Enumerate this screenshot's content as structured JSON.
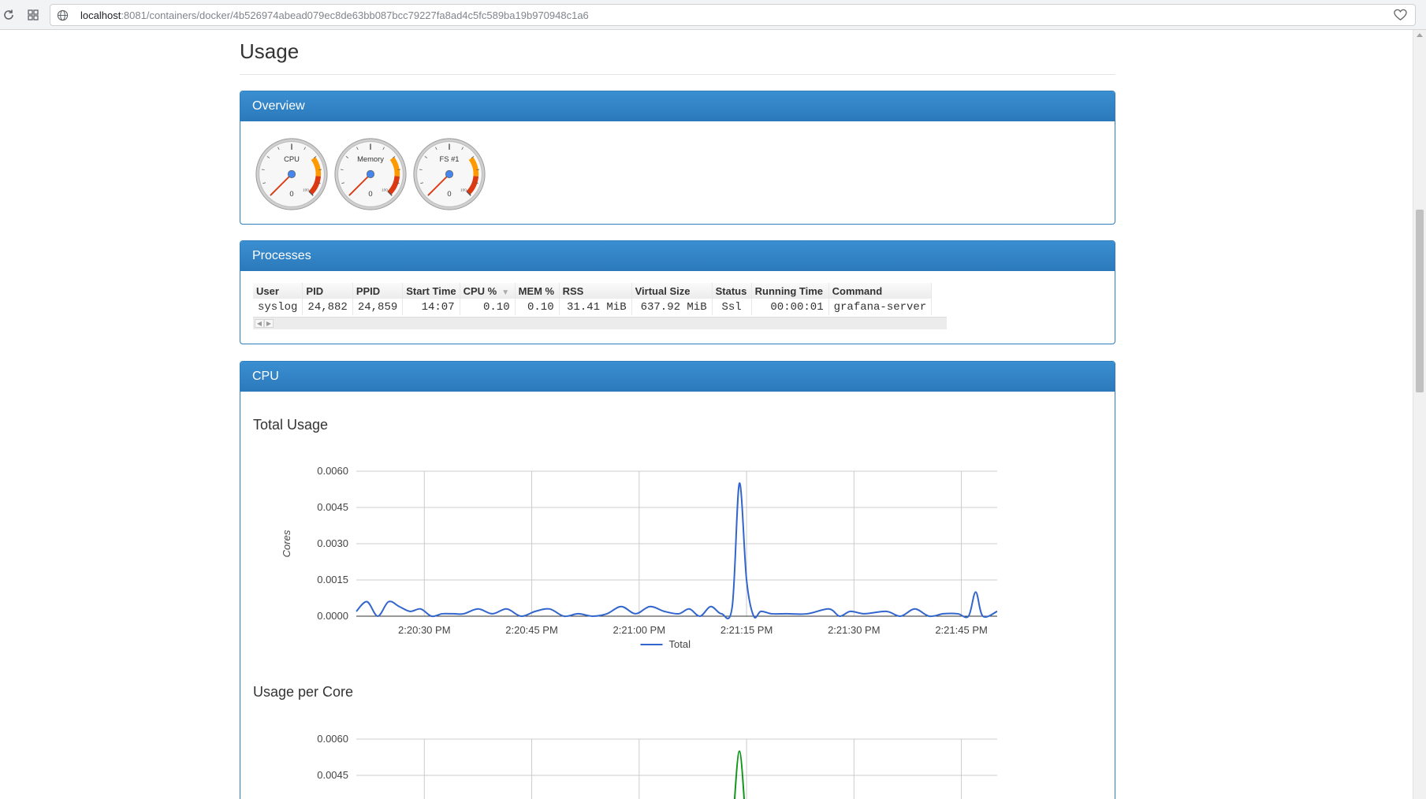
{
  "browser": {
    "url_host": "localhost",
    "url_path": ":8081/containers/docker/4b526974abead079ec8de63bb087bcc79227fa8ad4c5fc589ba19b970948c1a6"
  },
  "page": {
    "title": "Usage"
  },
  "overview": {
    "heading": "Overview",
    "gauges": [
      {
        "label": "CPU",
        "value": "0",
        "max_tick": "100",
        "level": 0
      },
      {
        "label": "Memory",
        "value": "0",
        "max_tick": "100",
        "level": 0
      },
      {
        "label": "FS #1",
        "value": "0",
        "max_tick": "100",
        "level": 0
      }
    ]
  },
  "processes": {
    "heading": "Processes",
    "columns": [
      "User",
      "PID",
      "PPID",
      "Start Time",
      "CPU %",
      "MEM %",
      "RSS",
      "Virtual Size",
      "Status",
      "Running Time",
      "Command"
    ],
    "sort_indicator": "▼",
    "rows": [
      [
        "syslog",
        "24,882",
        "24,859",
        "14:07",
        "0.10",
        "0.10",
        "31.41 MiB",
        "637.92 MiB",
        "Ssl",
        "00:00:01",
        "grafana-server"
      ]
    ]
  },
  "cpu": {
    "heading": "CPU",
    "total_title": "Total Usage",
    "per_core_title": "Usage per Core"
  },
  "colors": {
    "panel_header": "#2b79bb",
    "series_total": "#3366cc",
    "series_core": "#109618"
  },
  "chart_data": [
    {
      "type": "line",
      "title": "Total Usage",
      "ylabel": "Cores",
      "xlabel": "",
      "ylim": [
        0,
        0.006
      ],
      "yticks": [
        "0.0000",
        "0.0015",
        "0.0030",
        "0.0045",
        "0.0060"
      ],
      "xticks": [
        "2:20:30 PM",
        "2:20:45 PM",
        "2:21:00 PM",
        "2:21:15 PM",
        "2:21:30 PM",
        "2:21:45 PM"
      ],
      "x_start_s": 0,
      "x_tick_positions_s": [
        9.5,
        24.5,
        39.5,
        54.5,
        69.5,
        84.5
      ],
      "x_end_s": 89.5,
      "grid": true,
      "legend": "bottom",
      "series": [
        {
          "name": "Total",
          "x": [
            0,
            1.5,
            3,
            4.5,
            6,
            7.5,
            9,
            10.5,
            12,
            13.5,
            15,
            17,
            19,
            21,
            23,
            25,
            27,
            29,
            31,
            33,
            35,
            37,
            39,
            41,
            43,
            45,
            46.5,
            48,
            49.5,
            51,
            52.5,
            53.5,
            54.5,
            55.5,
            56.5,
            58,
            60,
            63,
            66,
            67.5,
            69,
            71,
            74,
            76,
            78,
            80,
            82,
            84,
            85.5,
            86.5,
            87.5,
            89.5
          ],
          "y": [
            0.0002,
            0.0006,
            0.0,
            0.0006,
            0.0004,
            0.0002,
            0.0003,
            0.0,
            0.0001,
            0.0001,
            0.0001,
            0.0003,
            0.0001,
            0.0003,
            0.0,
            0.0002,
            0.0003,
            0.0,
            0.0001,
            0.0,
            0.0001,
            0.0004,
            0.0001,
            0.0004,
            0.0002,
            0.0001,
            0.0003,
            0.0,
            0.0004,
            0.0001,
            0.0004,
            0.0055,
            0.0015,
            0.0,
            0.0002,
            0.0001,
            0.0001,
            0.0001,
            0.0003,
            0.0,
            0.0002,
            0.0001,
            0.0002,
            0.0,
            0.0003,
            0.0,
            0.0001,
            0.0001,
            0.0,
            0.001,
            0.0,
            0.0002
          ]
        }
      ]
    },
    {
      "type": "line",
      "title": "Usage per Core",
      "ylabel": "",
      "xlabel": "",
      "ylim": [
        0,
        0.006
      ],
      "yticks": [
        "0.0045",
        "0.0060"
      ],
      "grid": true,
      "series": [
        {
          "name": "",
          "x": [
            52.5,
            53.5,
            54.5
          ],
          "y": [
            0.002,
            0.0055,
            0.002
          ]
        }
      ]
    }
  ]
}
